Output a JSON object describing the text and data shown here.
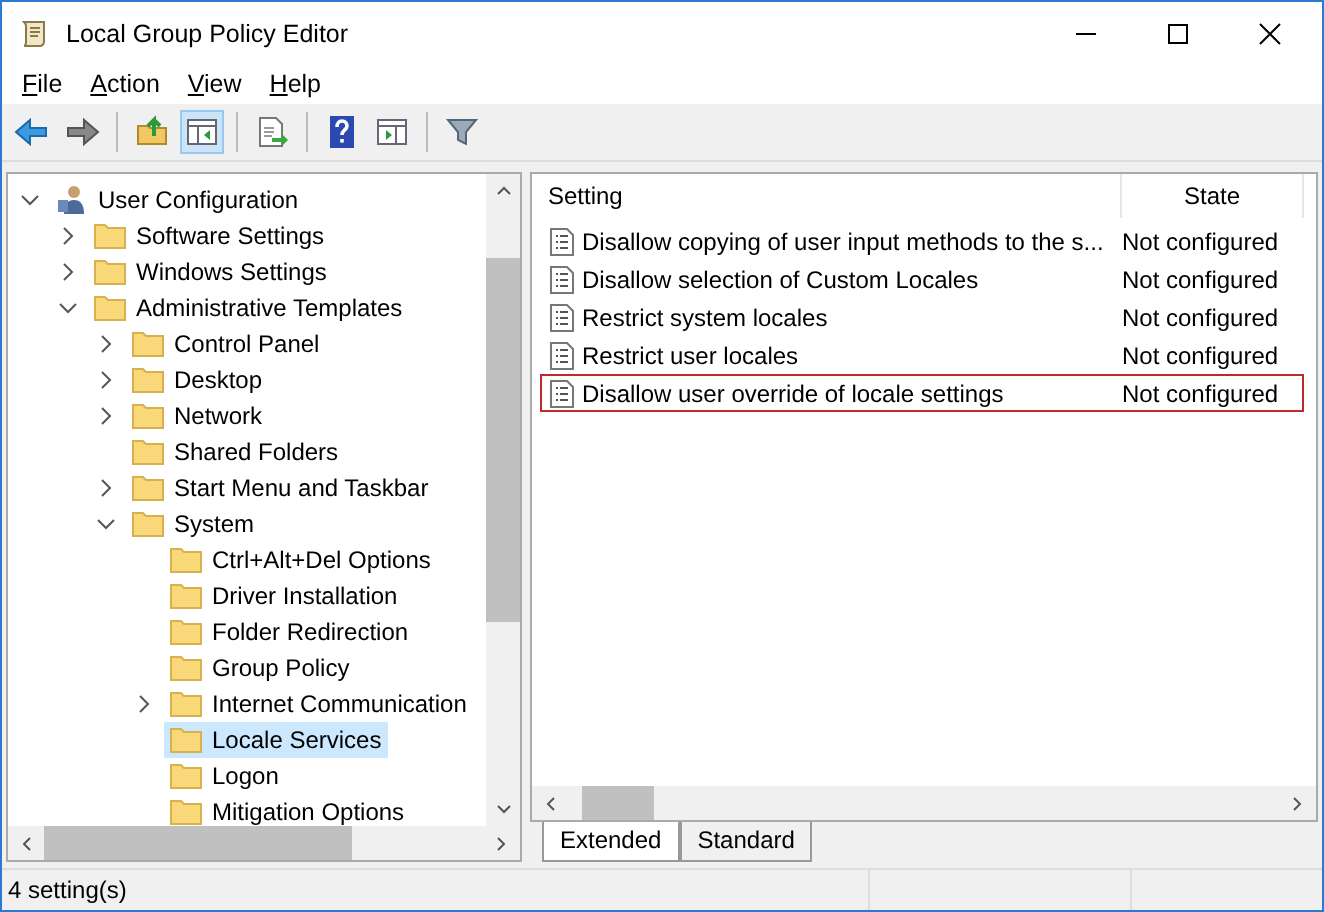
{
  "window": {
    "title": "Local Group Policy Editor"
  },
  "menu": [
    {
      "label": "File"
    },
    {
      "label": "Action"
    },
    {
      "label": "View"
    },
    {
      "label": "Help"
    }
  ],
  "toolbar": [
    {
      "kind": "back"
    },
    {
      "kind": "forward"
    },
    {
      "kind": "sep"
    },
    {
      "kind": "up"
    },
    {
      "kind": "tree",
      "pressed": true
    },
    {
      "kind": "sep"
    },
    {
      "kind": "export"
    },
    {
      "kind": "sep"
    },
    {
      "kind": "help"
    },
    {
      "kind": "panel"
    },
    {
      "kind": "sep"
    },
    {
      "kind": "filter"
    }
  ],
  "tree": [
    {
      "label": "User Configuration",
      "kind": "user",
      "expanded": true,
      "selected": false,
      "children": [
        {
          "label": "Software Settings",
          "kind": "folder",
          "expanded": false,
          "selected": false
        },
        {
          "label": "Windows Settings",
          "kind": "folder",
          "expanded": false,
          "selected": false
        },
        {
          "label": "Administrative Templates",
          "kind": "folder",
          "expanded": true,
          "selected": false,
          "children": [
            {
              "label": "Control Panel",
              "kind": "folder",
              "expanded": false,
              "selected": false
            },
            {
              "label": "Desktop",
              "kind": "folder",
              "expanded": false,
              "selected": false
            },
            {
              "label": "Network",
              "kind": "folder",
              "expanded": false,
              "selected": false
            },
            {
              "label": "Shared Folders",
              "kind": "folder",
              "selected": false
            },
            {
              "label": "Start Menu and Taskbar",
              "kind": "folder",
              "expanded": false,
              "selected": false
            },
            {
              "label": "System",
              "kind": "folder",
              "expanded": true,
              "selected": false,
              "children": [
                {
                  "label": "Ctrl+Alt+Del Options",
                  "kind": "folder",
                  "selected": false
                },
                {
                  "label": "Driver Installation",
                  "kind": "folder",
                  "selected": false
                },
                {
                  "label": "Folder Redirection",
                  "kind": "folder",
                  "selected": false
                },
                {
                  "label": "Group Policy",
                  "kind": "folder",
                  "selected": false
                },
                {
                  "label": "Internet Communication",
                  "kind": "folder",
                  "expanded": false,
                  "selected": false
                },
                {
                  "label": "Locale Services",
                  "kind": "folder",
                  "selected": true
                },
                {
                  "label": "Logon",
                  "kind": "folder",
                  "selected": false
                },
                {
                  "label": "Mitigation Options",
                  "kind": "folder",
                  "selected": false
                }
              ]
            }
          ]
        }
      ]
    }
  ],
  "table": {
    "columns": [
      "Setting",
      "State"
    ],
    "rows": [
      {
        "setting": "Disallow copying of user input methods to the s...",
        "state": "Not configured",
        "highlighted": false
      },
      {
        "setting": "Disallow selection of Custom Locales",
        "state": "Not configured",
        "highlighted": false
      },
      {
        "setting": "Restrict system locales",
        "state": "Not configured",
        "highlighted": false
      },
      {
        "setting": "Restrict user locales",
        "state": "Not configured",
        "highlighted": false
      },
      {
        "setting": "Disallow user override of locale settings",
        "state": "Not configured",
        "highlighted": true
      }
    ]
  },
  "tabs": [
    {
      "label": "Extended",
      "selected": true
    },
    {
      "label": "Standard",
      "selected": false
    }
  ],
  "status_bar": "4 setting(s)"
}
